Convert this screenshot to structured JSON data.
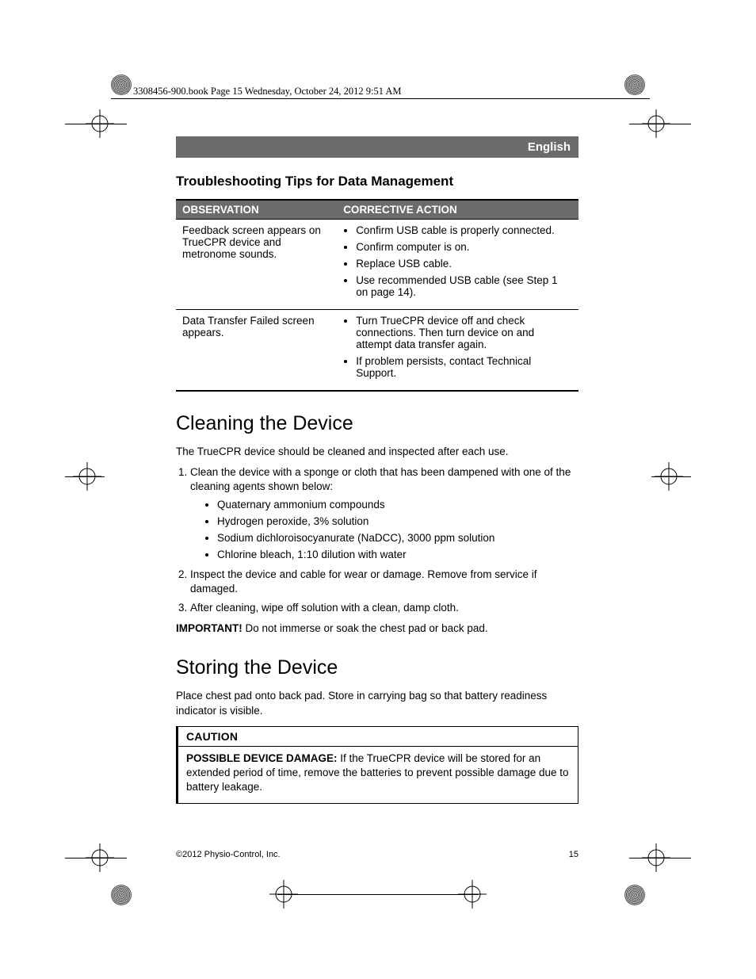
{
  "meta_line": "3308456-900.book  Page 15  Wednesday, October 24, 2012  9:51 AM",
  "language_label": "English",
  "troubleshooting_title": "Troubleshooting Tips for Data Management",
  "table": {
    "head_observation": "OBSERVATION",
    "head_action": "CORRECTIVE ACTION",
    "rows": [
      {
        "observation": "Feedback screen appears on TrueCPR device and metronome sounds.",
        "actions": [
          "Confirm USB cable is properly connected.",
          "Confirm computer is on.",
          "Replace USB cable.",
          "Use recommended USB cable (see Step 1 on page 14)."
        ]
      },
      {
        "observation": "Data Transfer Failed screen appears.",
        "actions": [
          "Turn TrueCPR device off and check connections. Then turn device on and attempt data transfer again.",
          "If problem persists, contact Technical Support."
        ]
      }
    ]
  },
  "cleaning": {
    "heading": "Cleaning the Device",
    "intro": "The TrueCPR device should be cleaned and inspected after each use.",
    "step1": "Clean the device with a sponge or cloth that has been dampened with one of the cleaning agents shown below:",
    "agents": [
      "Quaternary ammonium compounds",
      "Hydrogen peroxide, 3% solution",
      "Sodium dichloroisocyanurate (NaDCC), 3000 ppm solution",
      "Chlorine bleach, 1:10 dilution with water"
    ],
    "step2": "Inspect the device and cable for wear or damage. Remove from service if damaged.",
    "step3": "After cleaning, wipe off solution with a clean, damp cloth.",
    "important_label": "IMPORTANT!",
    "important_text": "  Do not immerse or soak the chest pad or back pad."
  },
  "storing": {
    "heading": "Storing the Device",
    "body": "Place chest pad onto back pad. Store in carrying bag so that battery readiness indicator is visible.",
    "caution_head": "CAUTION",
    "caution_lead": "POSSIBLE DEVICE DAMAGE:",
    "caution_body": "  If the TrueCPR device will be stored for an extended period of time, remove the batteries to prevent possible damage due to battery leakage."
  },
  "footer": {
    "copyright": "©2012 Physio-Control, Inc.",
    "page": "15"
  }
}
